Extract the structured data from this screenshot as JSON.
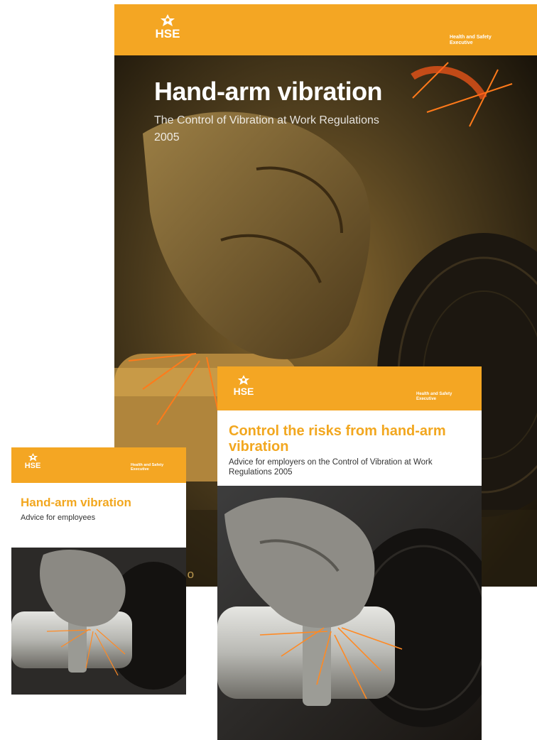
{
  "colors": {
    "hse_orange": "#f4a623",
    "title_orange": "#f2a71f",
    "dark_bg": "#2d2414"
  },
  "main_booklet": {
    "logo_text": "HSE",
    "org_name": "Health and Safety Executive",
    "title": "Hand-arm vibration",
    "subtitle": "The Control of Vibration at Work Regulations 2005",
    "footer_text": "ance o",
    "image_icon": "gloved-hand-grinder-photo"
  },
  "employers_booklet": {
    "logo_text": "HSE",
    "org_name": "Health and Safety Executive",
    "title": "Control the risks from hand-arm vibration",
    "subtitle": "Advice for employers on the Control of Vibration at Work Regulations 2005",
    "image_icon": "angle-grinder-sparks-photo"
  },
  "employees_booklet": {
    "logo_text": "HSE",
    "org_name": "Health and Safety Executive",
    "title": "Hand-arm vibration",
    "subtitle": "Advice for employees",
    "image_icon": "angle-grinder-sparks-photo"
  }
}
